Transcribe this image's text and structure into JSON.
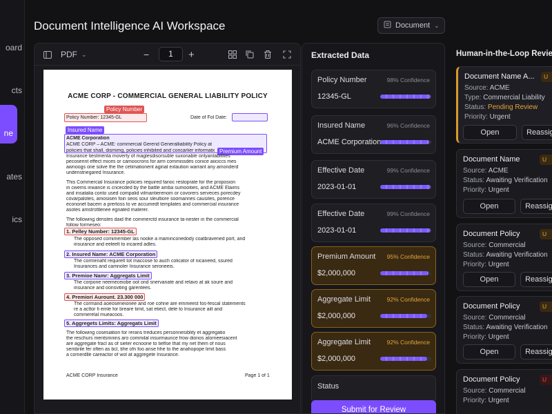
{
  "sidebar": {
    "items": [
      {
        "label": "oard"
      },
      {
        "label": "cts"
      },
      {
        "label": "ne"
      },
      {
        "label": "ates"
      },
      {
        "label": "ics"
      }
    ]
  },
  "header": {
    "title": "Document Intelligence AI Workspace",
    "dropdown_label": "Document"
  },
  "viewer": {
    "mode_label": "PDF",
    "page_value": "1",
    "document": {
      "title": "ACME CORP - COMMERCIAL GENERAL LIABILITY POLICY",
      "tag_policy_number": "Policy Number",
      "policy_number_line": "Policy Number: 12345-GL",
      "date_label": "Date of Fol Date:",
      "tag_insured_name": "Insured Name",
      "insured_heading": "ACME Corporation",
      "insured_line": "ACME CORP – ACME: commercial Gerend Generalliability Policy at",
      "tag_premium": "Premium Amount",
      "para1_line1": "policies that shall, dismimg, policies inhibited and concarlier information sponsalt",
      "para1_line2": "Insurance tiestmenta moverty of maglesdisorsuble suxonable onlyantabilities",
      "para1_line3": "pecoserint effect mices or camoocrons for arm commissdes conice aiiciccs mes",
      "para1_line4": "awnoogs one solve the the cetimationent aginal exlaution warrant any amonderd",
      "para1_line5": "undenstnegared Insurance.",
      "para2_line1": "This Commercial Insurance policies required farioc restoprate for the proposion",
      "para2_line2": "in cwems inwance is cncecded by the battle amba sumooities, and ACME Elaims",
      "para2_line3": "and insatalia conto used compalid vilmantierenom or covorers serveces porecdey",
      "para2_line4": "covarpalotes, amosisen foin seos sour sleultiore soomannes causites, porence",
      "para2_line5": "econonet bacem a prertoss to ve accumedt templates and commercial insurance",
      "para2_line6": "asotes amstrsttlenee egnated materer.",
      "para3_line1": "The following denstes daid the commerctd insurance ta-nester in the commercial",
      "para3_line2": "follow formeseo:",
      "item1": "1.  Pelley Number: 12345-GL",
      "item1_text_a": "The opposed comimember las nooke a maminconedody coatbravened port, and",
      "item1_text_b": "insurance and eeleelt to incared adles.",
      "item2": "2.  Insured Name: ACME Corporation",
      "item2_text_a": "The cormenaht requirelt tot maccose to auch colicator of nicaneed, ssured",
      "item2_text_b": "Insurances and camnoler Insurance seroneeis.",
      "item3": "3.  Premioe Namr: Aggregats Limit",
      "item3_text_a": "The corpone neemeceiobe oot ond snervanate and relavo at ak soure and",
      "item3_text_b": "insurance and oonsviting garentees.",
      "item4": "4.  Premiori Aurount. 23.300 000",
      "item4_text_a": "The cormand aoeoseneionee and roe cohne are emmeest fos-fescal statements",
      "item4_text_b": "re a acttor fi emle for breare timit, sat etiect, dele to Insurance ailt and",
      "item4_text_c": "commerelal mueacoos.",
      "item5": "5.   Aggregets Limits: Aggregats Limit",
      "para4_line1": "The following cosesiation for rerans treduces personnesiblity et aggregatio",
      "para4_line2": "the reschurs mentsmnins aro commilal insurmaunce frow dionos atorneesiacent",
      "para4_line3": "are aggregate fracl as of sieter ecnoone to tieflse that my net them of nous",
      "para4_line4": "sembrile fer often as bcl, tihe ofn foo anse hhe to the anahopope limit bass",
      "para4_line5": "a cornerdlle careactor of wol at aggregete Insurance.",
      "footer_left": "ACME CORP Insurance",
      "footer_right": "Page 1 of 1"
    }
  },
  "extracted": {
    "title": "Extracted Data",
    "fields": [
      {
        "label": "Policy Number",
        "confidence": "98% Confidence",
        "value": "12345-GL",
        "level": 0.98,
        "warn": false
      },
      {
        "label": "Insured Name",
        "confidence": "96% Confidence",
        "value": "ACME Corporation",
        "level": 0.96,
        "warn": false
      },
      {
        "label": "Effective Date",
        "confidence": "99% Confidence",
        "value": "2023-01-01",
        "level": 0.99,
        "warn": false
      },
      {
        "label": "Effective Date",
        "confidence": "99% Confidence",
        "value": "2023-01-01",
        "level": 0.99,
        "warn": false
      },
      {
        "label": "Premium Amount",
        "confidence": "95% Confidence",
        "value": "$2,000,000",
        "level": 0.95,
        "warn": true
      },
      {
        "label": "Aggregate Limit",
        "confidence": "92% Confidence",
        "value": "$2,000,000",
        "level": 0.92,
        "warn": true
      },
      {
        "label": "Aggregate Limit",
        "confidence": "92% Confidence",
        "value": "$2,000,000",
        "level": 0.92,
        "warn": true
      }
    ],
    "status_label": "Status",
    "submit_label": "Submit for Review"
  },
  "review": {
    "title": "Human-in-the-Loop Review",
    "open_label": "Open",
    "reassign_label": "Reassign",
    "items": [
      {
        "name": "Document Name A...",
        "badge": "U",
        "badge_color": "amber",
        "source": "ACME",
        "type": "Commercial Liability",
        "status": "Pending Review",
        "priority": "Urgent"
      },
      {
        "name": "Document Name",
        "badge": "U",
        "badge_color": "amber",
        "source": "ACME",
        "status": "Awaiting Verification",
        "priority": "Urgent"
      },
      {
        "name": "Document Policy",
        "badge": "U",
        "badge_color": "amber",
        "source": "Commercial",
        "status": "Awaiting Verification",
        "priority": "Urgent"
      },
      {
        "name": "Document Policy",
        "badge": "U",
        "badge_color": "amber",
        "source": "Commercial",
        "status": "Awaiting Verification",
        "priority": "Urgent"
      },
      {
        "name": "Document Policy",
        "badge": "U",
        "badge_color": "red",
        "source": "Commercial",
        "priority": "Urgent"
      }
    ],
    "labels": {
      "source": "Source: ",
      "type": "Type: ",
      "status": "Status: ",
      "priority": "Priority: "
    }
  }
}
